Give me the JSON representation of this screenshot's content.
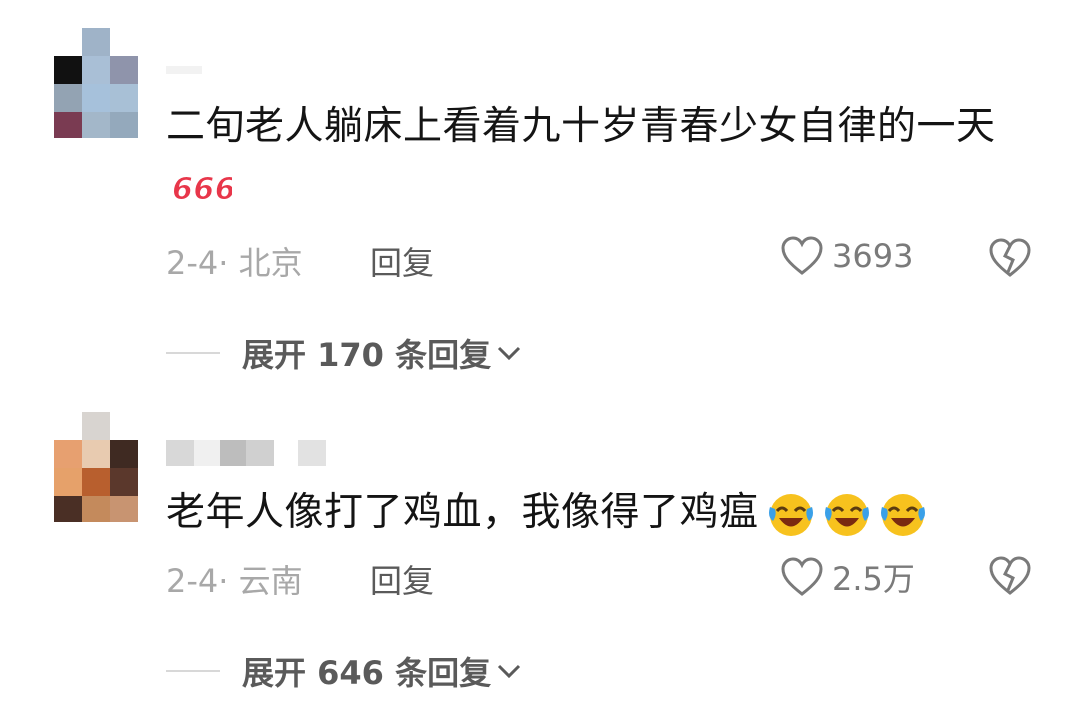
{
  "comments": [
    {
      "text": "二旬老人躺床上看着九十岁青春少女自律的一天",
      "date_location": "2-4· 北京",
      "reply_label": "回复",
      "like_count": "3693",
      "expand_label": "展开 170 条回复"
    },
    {
      "text": "老年人像打了鸡血，我像得了鸡瘟",
      "date_location": "2-4· 云南",
      "reply_label": "回复",
      "like_count": "2.5万",
      "expand_label": "展开 646 条回复"
    }
  ],
  "emoji_666": "666",
  "icons": {
    "like": "heart-outline-icon",
    "dislike": "broken-heart-icon",
    "expand": "chevron-down-icon",
    "reaction": "laughing-crying-emoji"
  },
  "colors": {
    "text": "#141414",
    "meta": "#a8a8a8",
    "action": "#5a5a5a",
    "emoji_red": "#e8364a",
    "emoji_yellow": "#f7c21e",
    "emoji_blue": "#3aa0e8"
  }
}
